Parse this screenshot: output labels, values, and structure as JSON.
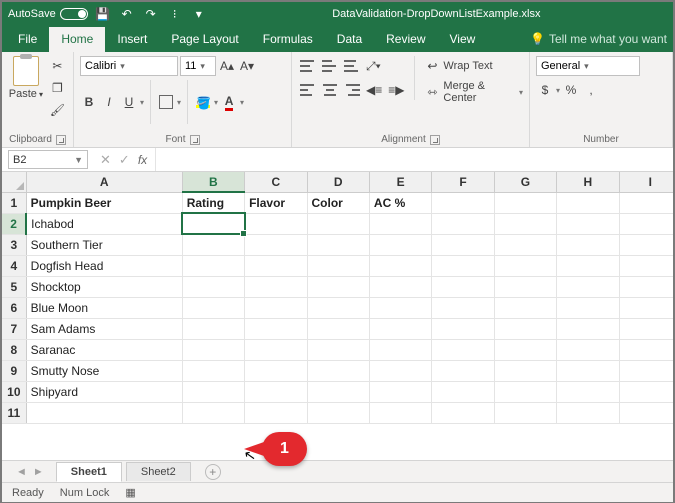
{
  "titlebar": {
    "autosave_label": "AutoSave",
    "autosave_state": "Off",
    "filename": "DataValidation-DropDownListExample.xlsx"
  },
  "tabs": {
    "file": "File",
    "home": "Home",
    "insert": "Insert",
    "page_layout": "Page Layout",
    "formulas": "Formulas",
    "data": "Data",
    "review": "Review",
    "view": "View",
    "tell_me": "Tell me what you want"
  },
  "ribbon": {
    "clipboard": {
      "label": "Clipboard",
      "paste": "Paste"
    },
    "font": {
      "label": "Font",
      "name": "Calibri",
      "size": "11",
      "bold": "B",
      "italic": "I",
      "underline": "U"
    },
    "alignment": {
      "label": "Alignment",
      "wrap": "Wrap Text",
      "merge": "Merge & Center"
    },
    "number": {
      "label": "Number",
      "format": "General",
      "currency": "$",
      "percent": "%"
    }
  },
  "fbar": {
    "name_box": "B2",
    "fx": "fx"
  },
  "grid": {
    "col_headers": [
      "A",
      "B",
      "C",
      "D",
      "E",
      "F",
      "G",
      "H",
      "I"
    ],
    "row_headers": [
      "1",
      "2",
      "3",
      "4",
      "5",
      "6",
      "7",
      "8",
      "9",
      "10",
      "11"
    ],
    "rows": [
      [
        "Pumpkin Beer",
        "Rating",
        "Flavor",
        "Color",
        "AC %",
        "",
        "",
        "",
        ""
      ],
      [
        "Ichabod",
        "",
        "",
        "",
        "",
        "",
        "",
        "",
        ""
      ],
      [
        "Southern Tier",
        "",
        "",
        "",
        "",
        "",
        "",
        "",
        ""
      ],
      [
        "Dogfish Head",
        "",
        "",
        "",
        "",
        "",
        "",
        "",
        ""
      ],
      [
        "Shocktop",
        "",
        "",
        "",
        "",
        "",
        "",
        "",
        ""
      ],
      [
        "Blue Moon",
        "",
        "",
        "",
        "",
        "",
        "",
        "",
        ""
      ],
      [
        "Sam Adams",
        "",
        "",
        "",
        "",
        "",
        "",
        "",
        ""
      ],
      [
        "Saranac",
        "",
        "",
        "",
        "",
        "",
        "",
        "",
        ""
      ],
      [
        "Smutty Nose",
        "",
        "",
        "",
        "",
        "",
        "",
        "",
        ""
      ],
      [
        "Shipyard",
        "",
        "",
        "",
        "",
        "",
        "",
        "",
        ""
      ],
      [
        "",
        "",
        "",
        "",
        "",
        "",
        "",
        "",
        ""
      ]
    ],
    "selected_cell": "B2"
  },
  "sheets": {
    "sheet1": "Sheet1",
    "sheet2": "Sheet2"
  },
  "statusbar": {
    "ready": "Ready",
    "numlock": "Num Lock"
  },
  "annotation": {
    "callout": "1"
  }
}
